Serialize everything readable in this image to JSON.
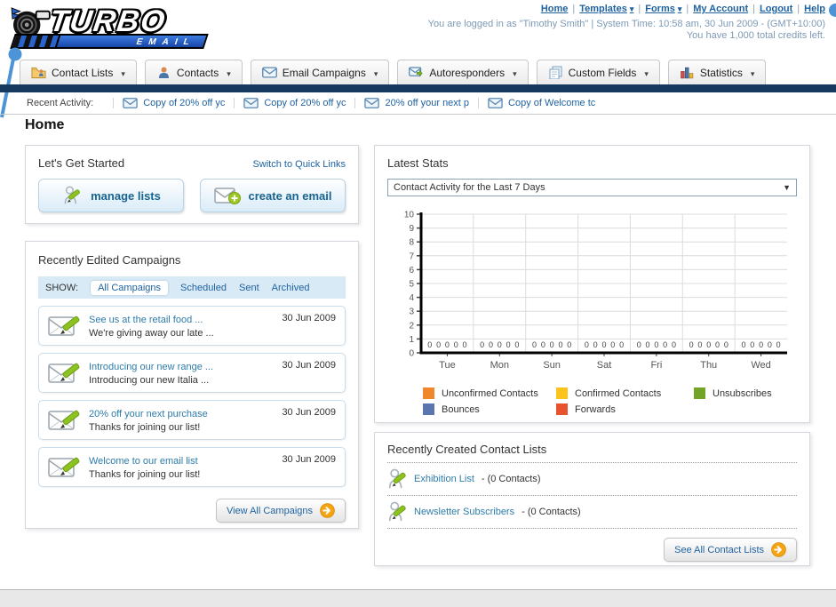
{
  "logo": {
    "primary": "TURBO",
    "secondary": "EMAIL"
  },
  "header": {
    "links": [
      {
        "label": "Home",
        "dropdown": false
      },
      {
        "label": "Templates",
        "dropdown": true
      },
      {
        "label": "Forms",
        "dropdown": true
      },
      {
        "label": "My Account",
        "dropdown": false
      },
      {
        "label": "Logout",
        "dropdown": false
      },
      {
        "label": "Help",
        "dropdown": false
      }
    ],
    "login_line": "You are logged in as \"Timothy Smith\" | System Time: 10:58 am, 30 Jun 2009 - (GMT+10:00)",
    "credits_line": "You have 1,000 total credits left."
  },
  "nav_tabs": [
    {
      "label": "Contact Lists",
      "icon": "folder-contacts-icon"
    },
    {
      "label": "Contacts",
      "icon": "person-icon"
    },
    {
      "label": "Email Campaigns",
      "icon": "envelope-icon"
    },
    {
      "label": "Autoresponders",
      "icon": "envelope-autoresponder-icon"
    },
    {
      "label": "Custom Fields",
      "icon": "pages-icon"
    },
    {
      "label": "Statistics",
      "icon": "bar-chart-icon"
    }
  ],
  "recent_activity": {
    "label": "Recent Activity:",
    "items": [
      "Copy of 20% off yc",
      "Copy of 20% off yc",
      "20% off your next p",
      "Copy of Welcome tc"
    ]
  },
  "page_title": "Home",
  "get_started": {
    "title": "Let's Get Started",
    "switch_link": "Switch to Quick Links",
    "buttons": [
      {
        "label": "manage lists"
      },
      {
        "label": "create an email"
      }
    ]
  },
  "campaigns_panel": {
    "title": "Recently Edited Campaigns",
    "show_label": "SHOW:",
    "tabs": [
      "All Campaigns",
      "Scheduled",
      "Sent",
      "Archived"
    ],
    "active_tab": "All Campaigns",
    "items": [
      {
        "title": "See us at the retail food ...",
        "subtitle": "We're giving away our late ...",
        "date": "30 Jun 2009"
      },
      {
        "title": "Introducing our new range ...",
        "subtitle": "Introducing our new Italia ...",
        "date": "30 Jun 2009"
      },
      {
        "title": "20% off your next purchase",
        "subtitle": "Thanks for joining our list!",
        "date": "30 Jun 2009"
      },
      {
        "title": "Welcome to our email list",
        "subtitle": "Thanks for joining our list!",
        "date": "30 Jun 2009"
      }
    ],
    "view_all_label": "View All Campaigns"
  },
  "stats_panel": {
    "title": "Latest Stats",
    "dropdown_value": "Contact Activity for the Last 7 Days",
    "chart_data": {
      "type": "bar",
      "title": "Contact Activity for the Last 7 Days",
      "categories": [
        "Tue",
        "Mon",
        "Sun",
        "Sat",
        "Fri",
        "Thu",
        "Wed"
      ],
      "series": [
        {
          "name": "Unconfirmed Contacts",
          "color": "#F0882B",
          "values": [
            0,
            0,
            0,
            0,
            0,
            0,
            0
          ]
        },
        {
          "name": "Confirmed Contacts",
          "color": "#FBC31C",
          "values": [
            0,
            0,
            0,
            0,
            0,
            0,
            0
          ]
        },
        {
          "name": "Unsubscribes",
          "color": "#73A428",
          "values": [
            0,
            0,
            0,
            0,
            0,
            0,
            0
          ]
        },
        {
          "name": "Bounces",
          "color": "#5B76AE",
          "values": [
            0,
            0,
            0,
            0,
            0,
            0,
            0
          ]
        },
        {
          "name": "Forwards",
          "color": "#E8532F",
          "values": [
            0,
            0,
            0,
            0,
            0,
            0,
            0
          ]
        }
      ],
      "ylim": [
        0,
        10
      ],
      "ytick_step": 1,
      "grid": true,
      "value_labels": true,
      "legend_position": "bottom"
    }
  },
  "contact_lists_panel": {
    "title": "Recently Created Contact Lists",
    "items": [
      {
        "name": "Exhibition List",
        "detail": "- (0 Contacts)"
      },
      {
        "name": "Newsletter Subscribers",
        "detail": "- (0 Contacts)"
      }
    ],
    "see_all_label": "See All Contact Lists"
  },
  "colors": {
    "navy_bar": "#16395f",
    "link_blue": "#1f62a0",
    "panel_tab_bg": "#d9eaf7",
    "button_text": "#17648e",
    "arrow_button": "#f5a511"
  }
}
